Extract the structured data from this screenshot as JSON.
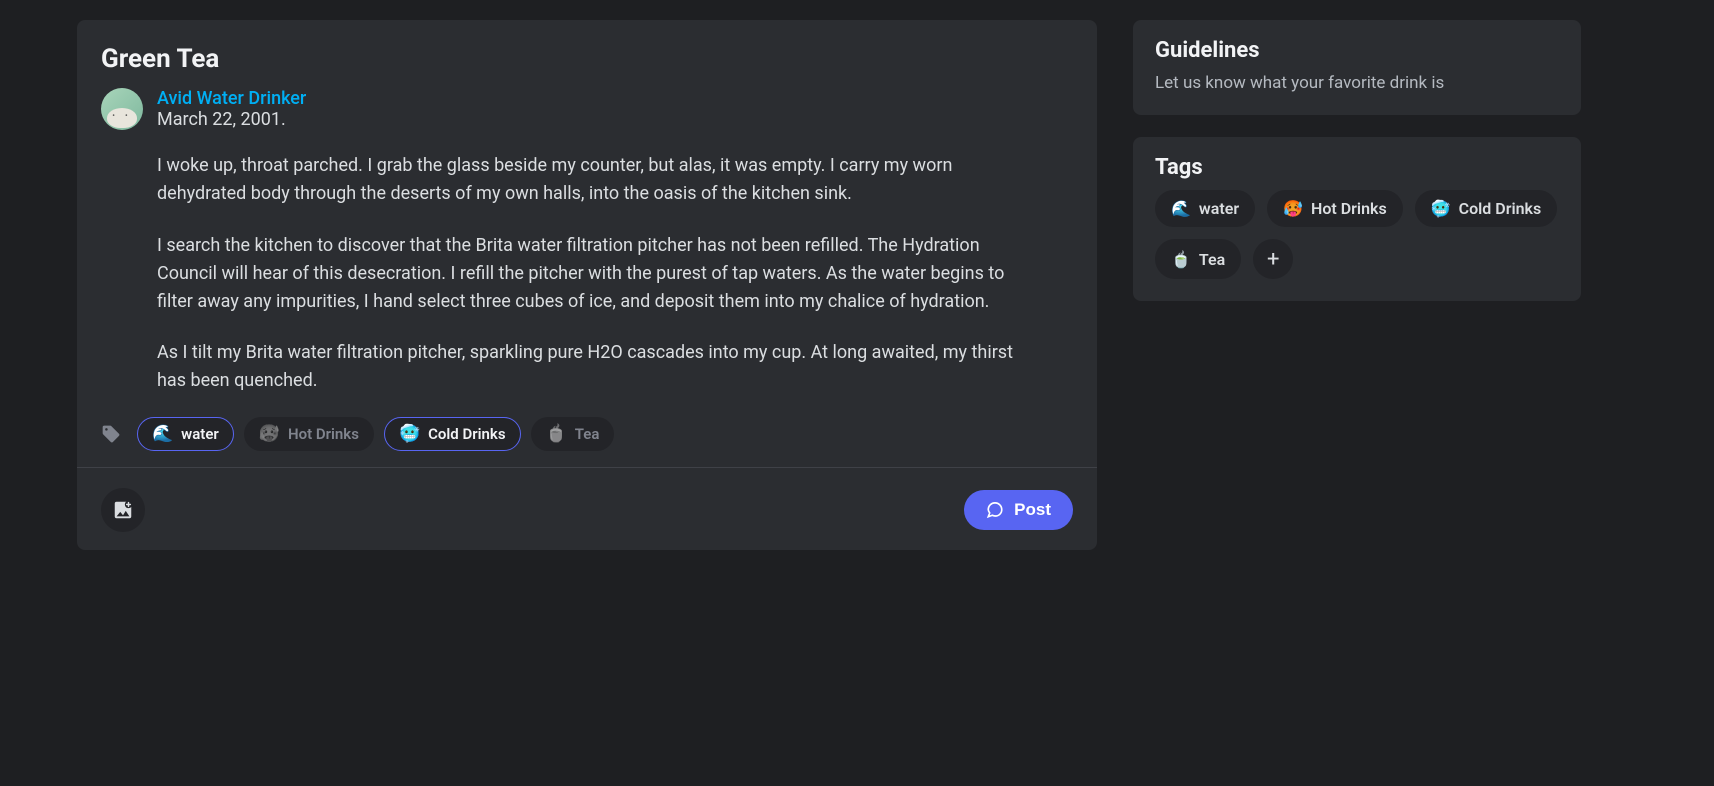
{
  "post": {
    "title": "Green Tea",
    "author": "Avid Water Drinker",
    "date": "March 22, 2001.",
    "body": {
      "p1": "I woke up, throat parched. I grab the glass beside my counter, but alas, it was empty. I carry my worn dehydrated body through the deserts of my own halls, into the oasis of the kitchen sink.",
      "p2": "I search the kitchen to discover that the Brita water filtration pitcher has not been refilled. The Hydration Council will hear of this desecration. I refill the pitcher with the purest of tap waters. As the water begins to filter away any impurities, I hand select three cubes of ice, and deposit them into my chalice of hydration.",
      "p3": "As I tilt my Brita water filtration pitcher, sparkling pure H2O cascades into my cup. At long awaited, my thirst has been quenched."
    }
  },
  "post_tags": {
    "water": {
      "emoji": "🌊",
      "label": "water"
    },
    "hot": {
      "emoji": "🥵",
      "label": "Hot Drinks"
    },
    "cold": {
      "emoji": "🥶",
      "label": "Cold Drinks"
    },
    "tea": {
      "emoji": "🍵",
      "label": "Tea"
    }
  },
  "footer": {
    "post_label": "Post"
  },
  "sidebar": {
    "guidelines": {
      "title": "Guidelines",
      "desc": "Let us know what your favorite drink is"
    },
    "tags": {
      "title": "Tags",
      "water": {
        "emoji": "🌊",
        "label": "water"
      },
      "hot": {
        "emoji": "🥵",
        "label": "Hot Drinks"
      },
      "cold": {
        "emoji": "🥶",
        "label": "Cold Drinks"
      },
      "tea": {
        "emoji": "🍵",
        "label": "Tea"
      }
    }
  }
}
